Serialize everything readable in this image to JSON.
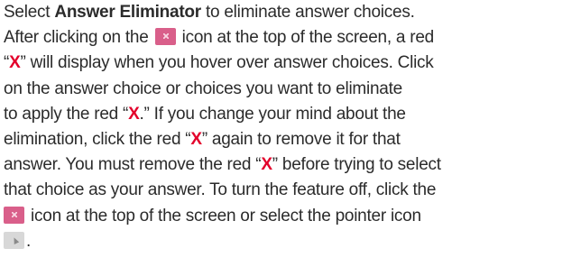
{
  "help": {
    "l1_pre": "Select ",
    "l1_bold": "Answer Eliminator",
    "l1_post": " to eliminate answer choices.",
    "l2_pre": "After clicking on the ",
    "l2_post": " icon at the top of the screen, a red",
    "l3_open_quote": "“",
    "l3_x": "X",
    "l3_rest": "” will display when you hover over answer choices. Click",
    "l4": "on the answer choice or choices you want to eliminate",
    "l5_pre": "to apply the red “",
    "l5_x": "X",
    "l5_post": ".” If you change your mind about the",
    "l6_pre": "elimination, click the red “",
    "l6_x": "X",
    "l6_post": "” again to remove it for that",
    "l7_pre": "answer. You must remove the red “",
    "l7_x": "X",
    "l7_post": "” before trying to select",
    "l8": "that choice as your answer. To turn the feature off, click the",
    "l9_post": " icon at the top of the screen or select the pointer icon",
    "l10_post": ".",
    "eliminator_icon": "answer-eliminator-icon",
    "pointer_icon": "pointer-icon"
  },
  "colors": {
    "text": "#2b2b2b",
    "red_x": "#e3002b",
    "eliminator_icon_bg": "#d95f8a",
    "pointer_icon_bg": "#d8d8d8"
  }
}
